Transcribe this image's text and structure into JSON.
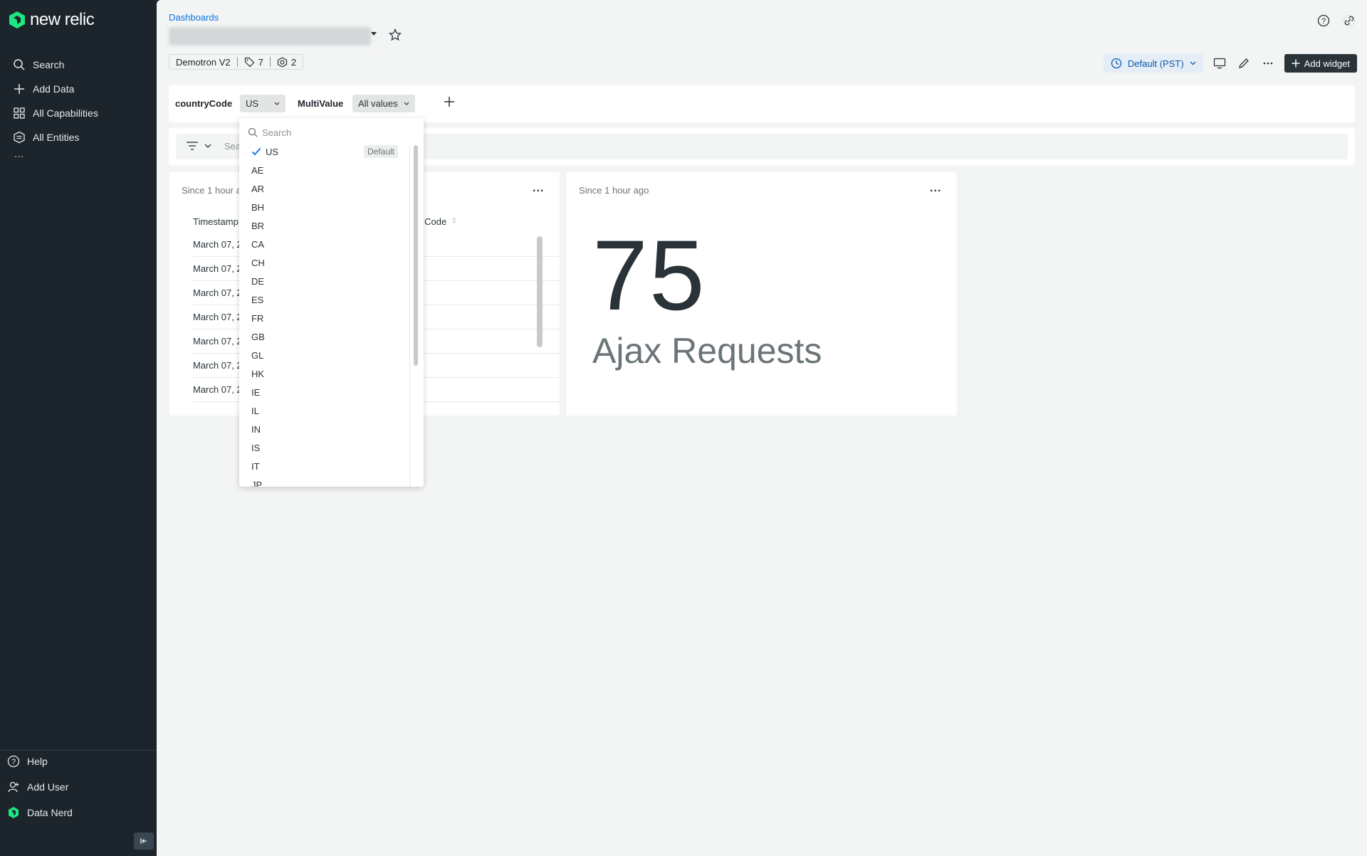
{
  "sidebar": {
    "logo_text": "new relic",
    "items": [
      {
        "label": "Search",
        "icon": "search-icon"
      },
      {
        "label": "Add Data",
        "icon": "plus-icon"
      },
      {
        "label": "All Capabilities",
        "icon": "grid-icon"
      },
      {
        "label": "All Entities",
        "icon": "entities-icon"
      }
    ],
    "more": "...",
    "bottom_items": [
      {
        "label": "Help",
        "icon": "help-icon"
      },
      {
        "label": "Add User",
        "icon": "add-user-icon"
      },
      {
        "label": "Data Nerd",
        "icon": "new-relic-logo-icon"
      }
    ]
  },
  "header": {
    "breadcrumb": "Dashboards",
    "account": "Demotron V2",
    "tag_count": "7",
    "entity_count": "2",
    "time_picker": "Default (PST)",
    "add_widget": "Add widget"
  },
  "variables": {
    "var1_label": "countryCode",
    "var1_value": "US",
    "var2_label": "MultiValue",
    "var2_value": "All values"
  },
  "filter": {
    "placeholder_partial": "Sea"
  },
  "table_widget": {
    "title_partial": "Since 1 hour a",
    "col1_partial": "Timestamp",
    "col2_partial": "y Code",
    "rows": [
      "March 07, 2",
      "March 07, 2",
      "March 07, 2",
      "March 07, 2",
      "March 07, 2",
      "March 07, 2",
      "March 07, 2"
    ]
  },
  "billboard_widget": {
    "title": "Since 1 hour ago",
    "value": "75",
    "label": "Ajax Requests"
  },
  "dropdown": {
    "search_placeholder": "Search",
    "selected": "US",
    "default_badge": "Default",
    "options": [
      "AE",
      "AR",
      "BH",
      "BR",
      "CA",
      "CH",
      "DE",
      "ES",
      "FR",
      "GB",
      "GL",
      "HK",
      "IE",
      "IL",
      "IN",
      "IS",
      "IT",
      "JP"
    ]
  },
  "colors": {
    "sidebar_bg": "#1d252c",
    "link_blue": "#0c74df",
    "brand_green": "#1ce783",
    "main_bg": "#f3f4f4"
  }
}
